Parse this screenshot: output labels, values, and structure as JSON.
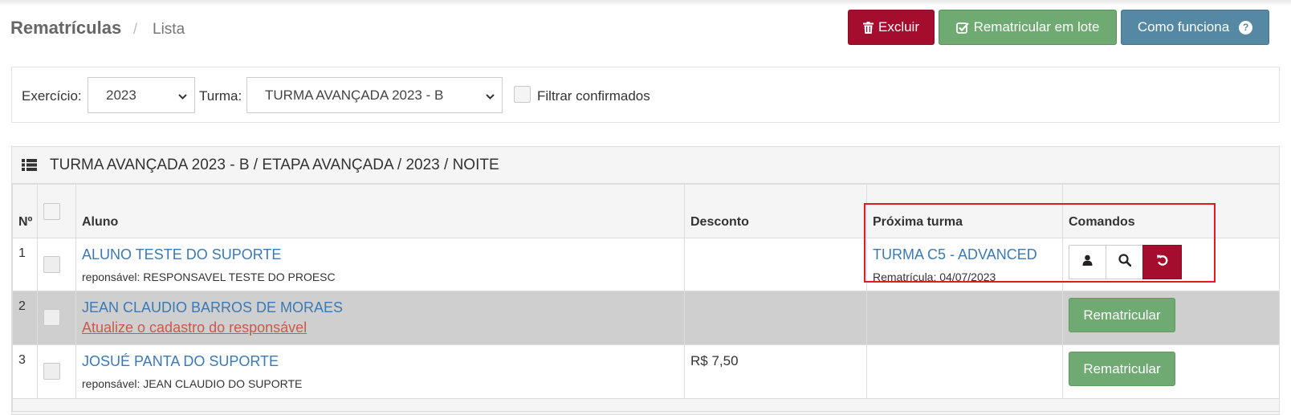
{
  "header": {
    "title": "Rematrículas",
    "separator": "/",
    "subtitle": "Lista",
    "buttons": {
      "excluir": "Excluir",
      "rematricular_lote": "Rematricular em lote",
      "como_funciona": "Como funciona",
      "help_glyph": "?"
    }
  },
  "filters": {
    "exercicio_label": "Exercício:",
    "exercicio_value": "2023",
    "turma_label": "Turma:",
    "turma_value": "TURMA AVANÇADA 2023 - B",
    "filtrar_label": "Filtrar confirmados"
  },
  "panel": {
    "title": "TURMA AVANÇADA 2023 - B / ETAPA AVANÇADA / 2023 / NOITE"
  },
  "table": {
    "columns": {
      "num": "Nº",
      "aluno": "Aluno",
      "desconto": "Desconto",
      "proxima_turma": "Próxima turma",
      "comandos": "Comandos"
    },
    "rows": [
      {
        "num": "1",
        "aluno": "ALUNO TESTE DO SUPORTE",
        "detail": "reponsável: RESPONSAVEL TESTE DO PROESC",
        "desconto": "",
        "proxima_turma": "TURMA C5 - ADVANCED",
        "rematricula": "Rematrícula: 04/07/2023"
      },
      {
        "num": "2",
        "aluno": "JEAN CLAUDIO BARROS DE MORAES",
        "detail": "Atualize o cadastro do responsável",
        "desconto": "",
        "action": "Rematricular"
      },
      {
        "num": "3",
        "aluno": "JOSUÉ PANTA DO SUPORTE",
        "detail": "reponsável: JEAN CLAUDIO DO SUPORTE",
        "desconto": "R$ 7,50",
        "action": "Rematricular"
      }
    ]
  },
  "colors": {
    "danger": "#a50d2e",
    "success": "#6eaa72",
    "info": "#5588a3",
    "link": "#3b79b5",
    "highlight": "#e11b22"
  },
  "icons": [
    "trash-icon",
    "check-square-icon",
    "help-circle-icon",
    "chevron-down-icon",
    "list-icon",
    "user-icon",
    "search-icon",
    "undo-icon"
  ]
}
